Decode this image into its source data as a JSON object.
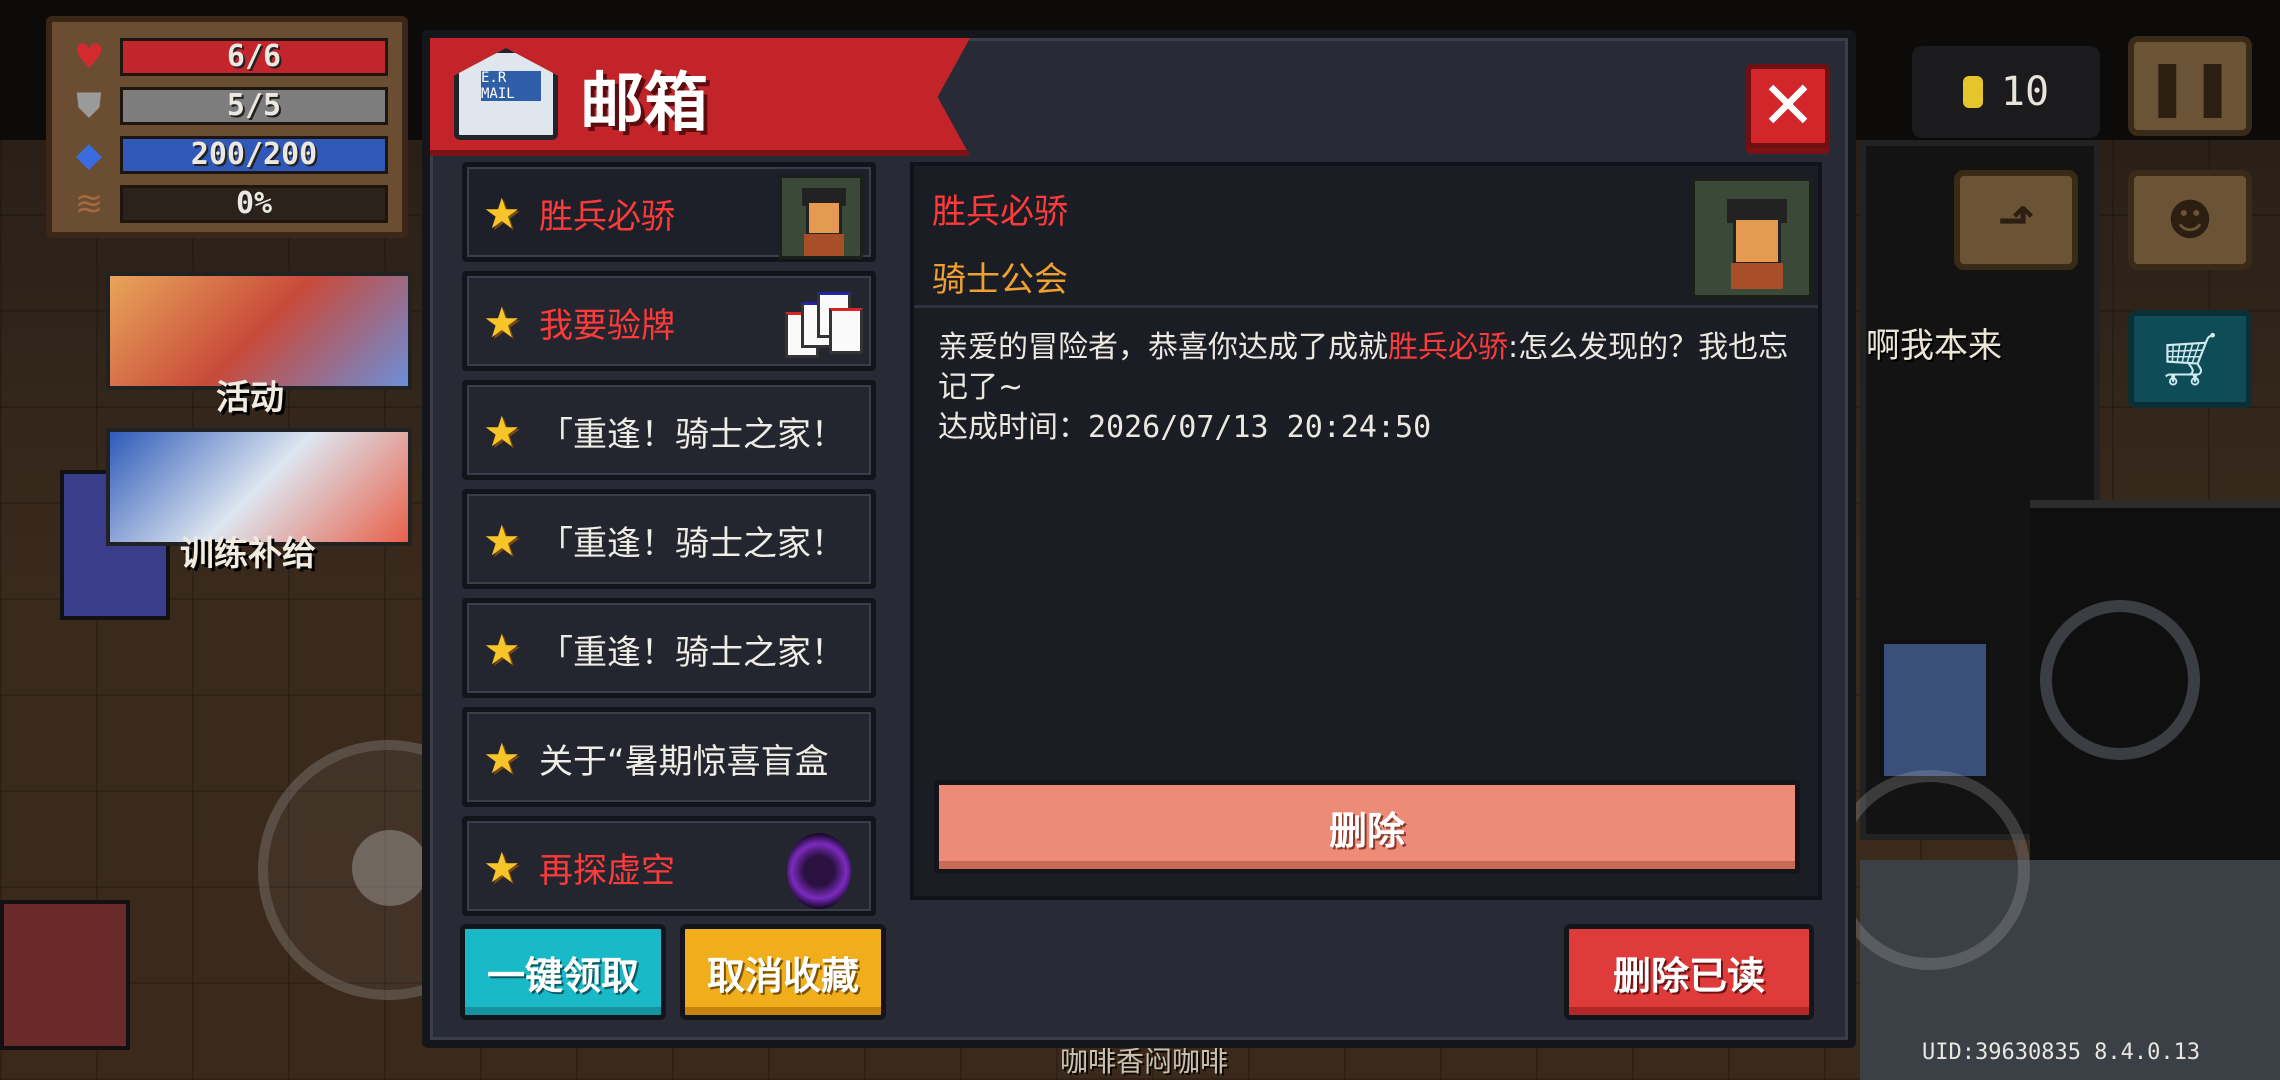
{
  "hud": {
    "health": {
      "text": "6/6",
      "fill": 1.0,
      "color": "#c2262c"
    },
    "armor": {
      "text": "5/5",
      "fill": 1.0,
      "color": "#7d7d7d"
    },
    "energy": {
      "text": "200/200",
      "fill": 1.0,
      "color": "#2f58b8"
    },
    "crit": {
      "text": "0%",
      "fill": 0.0,
      "color": "#6b4a2e"
    },
    "coins": "10"
  },
  "events": {
    "activity_label": "活动",
    "training_label": "训练补给"
  },
  "background": {
    "npc_speech": "啊我本来",
    "cafe_sign": "咖啡香闷咖啡",
    "uid": "UID:39630835 8.4.0.13"
  },
  "mailbox": {
    "title": "邮箱",
    "mail_icon_text": "E.R MAIL",
    "close_icon": "close-x-icon",
    "items": [
      {
        "title": "胜兵必骄",
        "highlight": true,
        "thumb": "knight",
        "selected": true
      },
      {
        "title": "我要验牌",
        "highlight": true,
        "thumb": "cards",
        "selected": false
      },
      {
        "title": "「重逢！骑士之家！",
        "highlight": false,
        "thumb": "",
        "selected": false
      },
      {
        "title": "「重逢！骑士之家！",
        "highlight": false,
        "thumb": "",
        "selected": false
      },
      {
        "title": "「重逢！骑士之家！",
        "highlight": false,
        "thumb": "",
        "selected": false
      },
      {
        "title": "关于“暑期惊喜盲盒",
        "highlight": false,
        "thumb": "",
        "selected": false
      },
      {
        "title": "再探虚空",
        "highlight": true,
        "thumb": "portal",
        "selected": false
      }
    ],
    "detail": {
      "title": "胜兵必骄",
      "sender": "骑士公会",
      "body_prefix": "亲爱的冒险者，恭喜你达成了成就",
      "body_highlight": "胜兵必骄",
      "body_suffix": ":怎么发现的？我也忘记了~",
      "time_label": "达成时间：",
      "time_value": "2026/07/13 20:24:50",
      "delete_label": "删除"
    },
    "buttons": {
      "claim_all": "一键领取",
      "unfavorite": "取消收藏",
      "delete_read": "删除已读"
    }
  }
}
